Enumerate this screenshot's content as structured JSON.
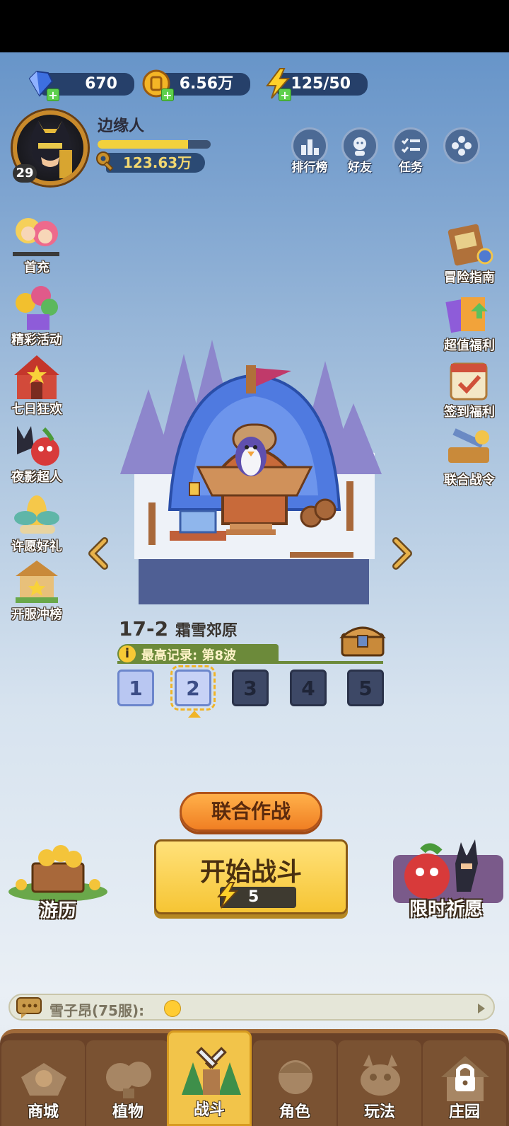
{
  "currencies": {
    "diamonds": "670",
    "gold": "6.56万",
    "energy": "125/50"
  },
  "profile": {
    "name": "边缘人",
    "level": "29",
    "xp_fraction": 0.8,
    "coins": "123.63万"
  },
  "top_buttons": {
    "ranking": "排行榜",
    "friends": "好友",
    "tasks": "任务"
  },
  "left_menu": [
    "首充",
    "精彩活动",
    "七日狂欢",
    "夜影超人",
    "许愿好礼",
    "开服冲榜"
  ],
  "right_menu": [
    "冒险指南",
    "超值福利",
    "签到福利",
    "联合战令"
  ],
  "stage": {
    "number": "17-2",
    "name": "霜雪郊原",
    "record": "最高记录: 第8波",
    "waves": [
      "1",
      "2",
      "3",
      "4",
      "5"
    ],
    "current_wave": 2
  },
  "actions": {
    "coop": "联合作战",
    "start": "开始战斗",
    "start_cost": "5",
    "travel": "游历",
    "wish": "限时祈愿"
  },
  "chat": {
    "text": "雪子昂(75服):"
  },
  "nav": {
    "shop": "商城",
    "plants": "植物",
    "battle": "战斗",
    "roles": "角色",
    "play": "玩法",
    "manor": "庄园"
  },
  "colors": {
    "accent_orange": "#f07f23",
    "start_yellow": "#f6c534",
    "nav_brown": "#6a4228"
  }
}
